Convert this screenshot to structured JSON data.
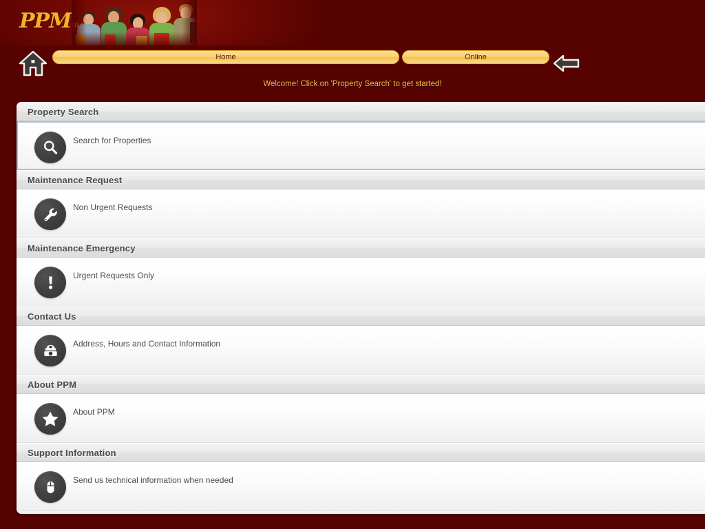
{
  "theme": {
    "background": "#550200",
    "tab_color": "#f8cf6c",
    "tab_text": "#4b1505",
    "welcome_text_color": "#f3bb45",
    "panel_background": "#f2f2f2",
    "selected_border": "#a8c0dd",
    "icon_background": "#3a3a3a"
  },
  "header": {
    "logo_text": "PPM",
    "logo_suffix": "inc.",
    "photo_alt": "five smiling people holding colorful shopping bags"
  },
  "navbar": {
    "home_icon": "home-icon",
    "back_icon": "back-arrow-icon",
    "tabs": [
      {
        "label": "Home",
        "name": "tab-home"
      },
      {
        "label": "Online",
        "name": "tab-online"
      }
    ]
  },
  "welcome_message": "Welcome! Click on 'Property Search' to get started!",
  "panel": {
    "sections": [
      {
        "header": "Property Search",
        "item": {
          "label": "Search for Properties",
          "icon": "magnifier-icon",
          "selected": true
        }
      },
      {
        "header": "Maintenance Request",
        "item": {
          "label": "Non Urgent Requests",
          "icon": "wrench-icon",
          "selected": false
        }
      },
      {
        "header": "Maintenance Emergency",
        "item": {
          "label": "Urgent Requests Only",
          "icon": "exclamation-icon",
          "selected": false
        }
      },
      {
        "header": "Contact Us",
        "item": {
          "label": "Address, Hours and Contact Information",
          "icon": "telephone-icon",
          "selected": false
        }
      },
      {
        "header": "About PPM",
        "item": {
          "label": "About PPM",
          "icon": "star-icon",
          "selected": false
        }
      },
      {
        "header": "Support Information",
        "item": {
          "label": "Send us technical information when needed",
          "icon": "mouse-icon",
          "selected": false
        }
      }
    ]
  }
}
